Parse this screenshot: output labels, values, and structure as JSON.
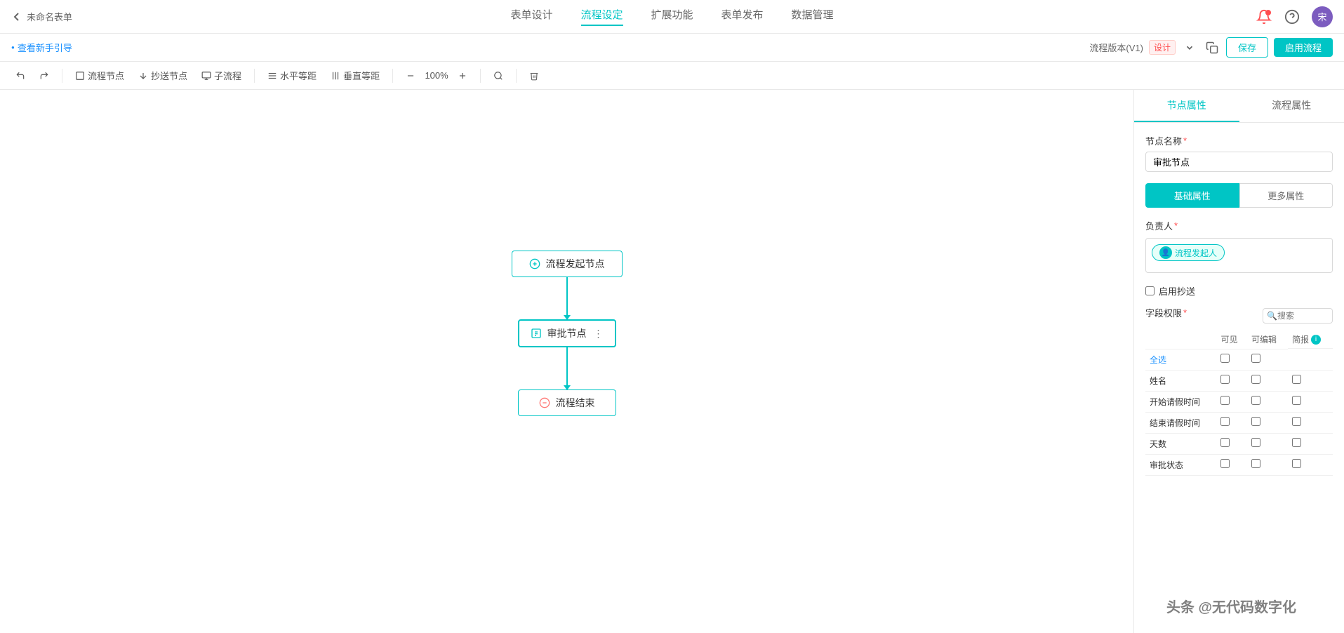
{
  "header": {
    "back_label": "未命名表单",
    "nav_items": [
      {
        "label": "表单设计",
        "active": false
      },
      {
        "label": "流程设定",
        "active": true
      },
      {
        "label": "扩展功能",
        "active": false
      },
      {
        "label": "表单发布",
        "active": false
      },
      {
        "label": "数据管理",
        "active": false
      }
    ],
    "avatar_label": "宋"
  },
  "subheader": {
    "guide_text": "查看新手引导",
    "version_text": "流程版本(V1)",
    "version_badge": "设计",
    "save_btn": "保存",
    "enable_btn": "启用流程"
  },
  "toolbar": {
    "items": [
      {
        "label": "流程节点",
        "icon": "node-icon"
      },
      {
        "label": "抄送节点",
        "icon": "copy-icon"
      },
      {
        "label": "子流程",
        "icon": "sub-icon"
      },
      {
        "label": "水平等距",
        "icon": "h-align-icon"
      },
      {
        "label": "垂直等距",
        "icon": "v-align-icon"
      }
    ],
    "zoom_value": "100%"
  },
  "flow": {
    "start_node": "流程发起节点",
    "approval_node": "审批节点",
    "end_node": "流程结束"
  },
  "right_panel": {
    "tabs": [
      {
        "label": "节点属性",
        "active": true
      },
      {
        "label": "流程属性",
        "active": false
      }
    ],
    "node_name_label": "节点名称",
    "node_name_value": "审批节点",
    "attr_tabs": [
      {
        "label": "基础属性",
        "active": true
      },
      {
        "label": "更多属性",
        "active": false
      }
    ],
    "responsible_label": "负责人",
    "responsible_person": "流程发起人",
    "copy_send_label": "启用抄送",
    "field_permission_label": "字段权限",
    "field_search_placeholder": "搜索",
    "table_headers": [
      "可见",
      "可编辑",
      "简报"
    ],
    "select_all_label": "全选",
    "fields": [
      {
        "name": "姓名"
      },
      {
        "name": "开始请假时间"
      },
      {
        "name": "结束请假时间"
      },
      {
        "name": "天数"
      },
      {
        "name": "审批状态"
      }
    ]
  },
  "watermark": "头条 @无代码数字化"
}
